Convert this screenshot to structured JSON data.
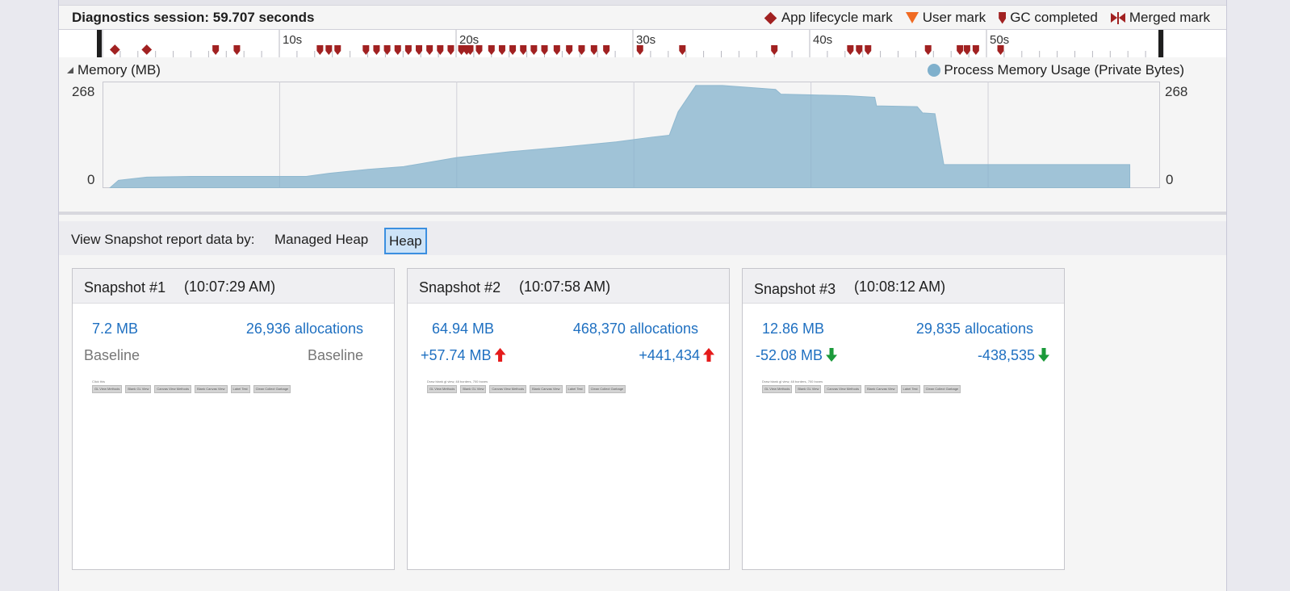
{
  "header": {
    "session_title": "Diagnostics session: 59.707 seconds",
    "legend": [
      {
        "label": "App lifecycle mark",
        "icon": "diamond-icon",
        "color": "#a12121"
      },
      {
        "label": "User mark",
        "icon": "triangle-icon",
        "color": "#f06a22"
      },
      {
        "label": "GC completed",
        "icon": "gc-marker-icon",
        "color": "#a12121"
      },
      {
        "label": "Merged mark",
        "icon": "merged-mark-icon",
        "color": "#a12121"
      }
    ]
  },
  "ruler": {
    "ticks": [
      "10s",
      "20s",
      "30s",
      "40s",
      "50s"
    ],
    "app_lifecycle_marks_s": [
      0.7,
      2.5
    ],
    "gc_marks_s": [
      6.4,
      7.6,
      12.3,
      12.8,
      13.3,
      14.9,
      15.5,
      16.1,
      16.7,
      17.3,
      17.9,
      18.5,
      19.1,
      19.7,
      20.3,
      20.6,
      20.8,
      21.3,
      22.0,
      22.6,
      23.2,
      23.8,
      24.4,
      25.0,
      25.7,
      26.4,
      27.1,
      27.8,
      28.5,
      30.4,
      32.8,
      38.0,
      42.3,
      42.8,
      43.3,
      46.7,
      48.5,
      48.9,
      49.4,
      50.8
    ]
  },
  "memory": {
    "title": "Memory (MB)",
    "series_label": "Process Memory Usage (Private Bytes)",
    "series_color": "#7fb0cc",
    "y_max_label": "268",
    "y_min_label": "0"
  },
  "chart_data": {
    "type": "area",
    "title": "Memory (MB)",
    "xlabel": "",
    "ylabel": "",
    "xlim": [
      0,
      59.707
    ],
    "ylim": [
      0,
      268
    ],
    "series": [
      {
        "name": "Process Memory Usage (Private Bytes)",
        "x": [
          0.4,
          0.9,
          2.5,
          5,
          10,
          11.5,
          12.8,
          15,
          17,
          20,
          23,
          26,
          29,
          31,
          32,
          32.5,
          33.5,
          35,
          38,
          38.3,
          40,
          42,
          43.6,
          43.7,
          46,
          46.3,
          47,
          47.5,
          58
        ],
        "y": [
          0,
          20,
          28,
          30,
          30,
          30,
          38,
          48,
          55,
          78,
          93,
          105,
          118,
          130,
          135,
          195,
          262,
          262,
          252,
          240,
          238,
          236,
          232,
          210,
          208,
          192,
          190,
          60,
          60
        ]
      }
    ]
  },
  "viewbar": {
    "label": "View Snapshot report data by:",
    "options": [
      "Managed Heap",
      "Heap"
    ],
    "active": "Heap"
  },
  "snapshots": [
    {
      "name": "Snapshot #1",
      "time": "(10:07:29 AM)",
      "size": "7.2 MB",
      "allocations": "26,936 allocations",
      "size_diff": "Baseline",
      "alloc_diff": "Baseline",
      "trend": "none",
      "thumb_title": "Click this",
      "thumb_buttons": [
        "GL View Methods",
        "Blank GL View",
        "Canvas View Methods",
        "Blank Canvas View",
        "Label Test",
        "Clean Collect Garbage"
      ]
    },
    {
      "name": "Snapshot #2",
      "time": "(10:07:58 AM)",
      "size": "64.94 MB",
      "allocations": "468,370 allocations",
      "size_diff": "+57.74 MB",
      "alloc_diff": "+441,434",
      "trend": "up",
      "thumb_title": "Draw blank gl view, 48 borders, 700 boxes",
      "thumb_buttons": [
        "GL View Methods",
        "Blank GL View",
        "Canvas View Methods",
        "Blank Canvas View",
        "Label Test",
        "Clean Collect Garbage"
      ]
    },
    {
      "name": "Snapshot #3",
      "time": "(10:08:12 AM)",
      "size": "12.86 MB",
      "allocations": "29,835 allocations",
      "size_diff": "-52.08 MB",
      "alloc_diff": "-438,535",
      "trend": "down",
      "thumb_title": "Draw blank gl view, 48 borders, 700 boxes",
      "thumb_buttons": [
        "GL View Methods",
        "Blank GL View",
        "Canvas View Methods",
        "Blank Canvas View",
        "Label Test",
        "Clean Collect Garbage"
      ]
    }
  ]
}
